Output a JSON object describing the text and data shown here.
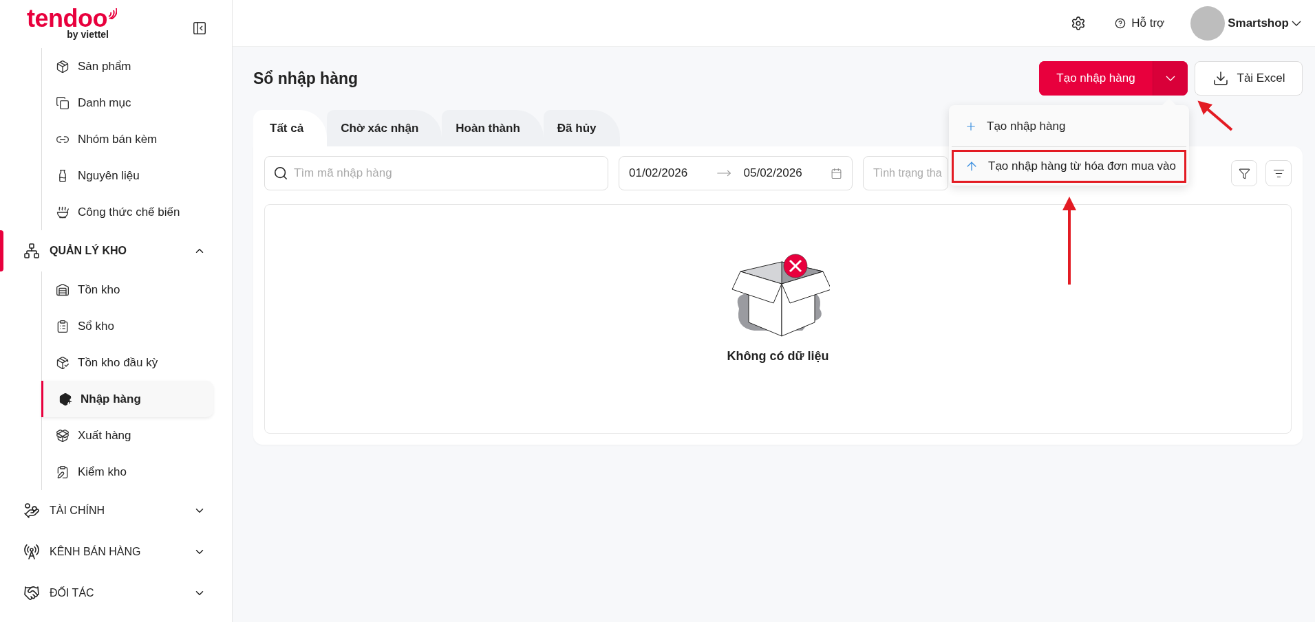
{
  "sidebar": {
    "logo": {
      "brand": "tendoo",
      "tagline": "by viettel"
    },
    "upper_items": [
      {
        "label": "Sản phẩm",
        "selected": false
      },
      {
        "label": "Danh mục",
        "selected": false
      },
      {
        "label": "Nhóm bán kèm",
        "selected": false
      },
      {
        "label": "Nguyên liệu",
        "selected": false
      },
      {
        "label": "Công thức chế biến",
        "selected": false
      }
    ],
    "groups": [
      {
        "label": "QUẢN LÝ KHO",
        "active": true,
        "expanded": true,
        "children": [
          {
            "label": "Tồn kho",
            "selected": false
          },
          {
            "label": "Sổ kho",
            "selected": false
          },
          {
            "label": "Tồn kho đầu kỳ",
            "selected": false
          },
          {
            "label": "Nhập hàng",
            "selected": true
          },
          {
            "label": "Xuất hàng",
            "selected": false
          },
          {
            "label": "Kiểm kho",
            "selected": false
          }
        ]
      },
      {
        "label": "TÀI CHÍNH",
        "active": false,
        "expanded": false
      },
      {
        "label": "KÊNH BÁN HÀNG",
        "active": false,
        "expanded": false
      },
      {
        "label": "ĐỐI TÁC",
        "active": false,
        "expanded": false
      }
    ]
  },
  "header": {
    "help": "Hỗ trợ",
    "user": "Smartshop"
  },
  "page": {
    "title": "Sổ nhập hàng",
    "create_button": {
      "label": "Tạo nhập hàng",
      "menu_open": true
    },
    "export_button": {
      "label": "Tải Excel"
    },
    "menu": [
      {
        "kind": "plus",
        "label": "Tạo nhập hàng",
        "highlighted": false
      },
      {
        "kind": "upload",
        "label": "Tạo nhập hàng từ hóa đơn mua vào",
        "highlighted": true
      }
    ],
    "tabs": [
      {
        "label": "Tất cả",
        "selected": true
      },
      {
        "label": "Chờ xác nhận",
        "selected": false
      },
      {
        "label": "Hoàn thành",
        "selected": false
      },
      {
        "label": "Đã hủy",
        "selected": false
      }
    ],
    "filters": {
      "search": {
        "placeholder": "Tìm mã nhập hàng"
      },
      "date_from": "01/02/2026",
      "date_to": "05/02/2026",
      "status": {
        "placeholder": "Tình trạng tha"
      }
    },
    "empty": {
      "message": "Không có dữ liệu"
    }
  }
}
